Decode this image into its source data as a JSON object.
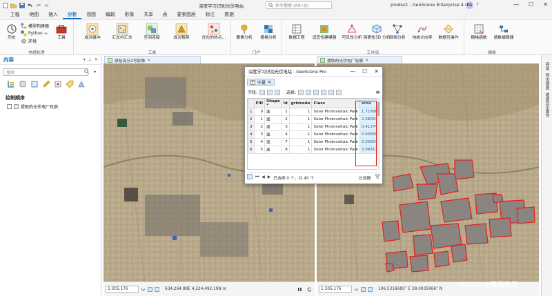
{
  "titlebar": {
    "doc_title": "深度学习识别光伏电站",
    "search_placeholder": "命令搜索 (Alt+Q)",
    "app_title": "product - GeoScene Enterprise 4.0",
    "user_initials": "PG",
    "help": "?",
    "min": "—",
    "max": "☐",
    "close": "✕"
  },
  "tabs": [
    "工程",
    "地图",
    "插入",
    "分析",
    "视图",
    "编辑",
    "影像",
    "共享",
    "表",
    "要素图层",
    "标注",
    "数据"
  ],
  "active_tab": "分析",
  "ribbon": {
    "geoprocessing": {
      "label": "地理处理",
      "history": "历史",
      "model_builder": "模型构建器",
      "python": "Python",
      "environment": "环境",
      "tools": "工具"
    },
    "tools_group": {
      "label": "工具",
      "items": [
        "成对缓冲",
        "汇总内汇总",
        "空间连接",
        "成对裁剪",
        "优化的热点..."
      ]
    },
    "portal": {
      "label": "门户",
      "feature_analysis": "要素分析",
      "raster_analysis": "栅格分析"
    },
    "workflows": {
      "label": "工作流",
      "data_engineering": "数据工程",
      "suitability": "适宜性建模器",
      "visibility": "可见性分析",
      "spatial_3d": "探索性3D 分析",
      "network": "网络分析",
      "geocoding": "地统计向导",
      "data_interop": "数据互操作"
    },
    "raster": {
      "label": "栅格",
      "raster_functions": "栅格函数",
      "function_editor": "函数编辑器"
    }
  },
  "contents": {
    "title": "内容",
    "search_placeholder": "搜索",
    "draw_order": "绘制顺序",
    "layer": "提取的光伏电厂轮廓"
  },
  "views": {
    "left_tab": "原始高分2号影像",
    "right_tab": "提取的光伏电厂轮廓",
    "left_scale": "1:305,176",
    "right_scale": "1:305,176",
    "left_coord": "634,264.88E 4,224,492.19N m",
    "right_coord": "106.5316685° E 38.0035666° N"
  },
  "right_side": [
    "目录",
    "导出地图",
    "地图显示属性"
  ],
  "dialog": {
    "title": "深度学习识别光伏电站 - GeoScene Pro",
    "tab": "宁夏",
    "fields_label": "字段:",
    "selection_label": "选择:",
    "columns": [
      "FID",
      "Shape *",
      "Id",
      "gridcode",
      "Class",
      "area"
    ],
    "rows": [
      {
        "n": "1",
        "fid": "0",
        "shape": "面",
        "id": "1",
        "grid": "1",
        "cls": "Solar Photovoltaic Park",
        "area": "1.716864"
      },
      {
        "n": "2",
        "fid": "1",
        "shape": "面",
        "id": "2",
        "grid": "1",
        "cls": "Solar Photovoltaic Park",
        "area": "2.380531"
      },
      {
        "n": "3",
        "fid": "2",
        "shape": "面",
        "id": "3",
        "grid": "1",
        "cls": "Solar Photovoltaic Park",
        "area": "0.412745"
      },
      {
        "n": "4",
        "fid": "3",
        "shape": "面",
        "id": "4",
        "grid": "1",
        "cls": "Solar Photovoltaic Park",
        "area": "0.938396"
      },
      {
        "n": "5",
        "fid": "4",
        "shape": "面",
        "id": "7",
        "grid": "1",
        "cls": "Solar Photovoltaic Park",
        "area": "0.359539"
      },
      {
        "n": "6",
        "fid": "5",
        "shape": "面",
        "id": "8",
        "grid": "1",
        "cls": "Solar Photovoltaic Park",
        "area": "3.068114"
      }
    ],
    "status": "已选择 0 个，共 40 个",
    "filter_label": "过滤器:"
  },
  "watermark": "CSDU @极海拾贝",
  "colors": {
    "accent": "#1a6fb5",
    "highlight": "#e02020",
    "area_cell": "#dff0fa"
  }
}
